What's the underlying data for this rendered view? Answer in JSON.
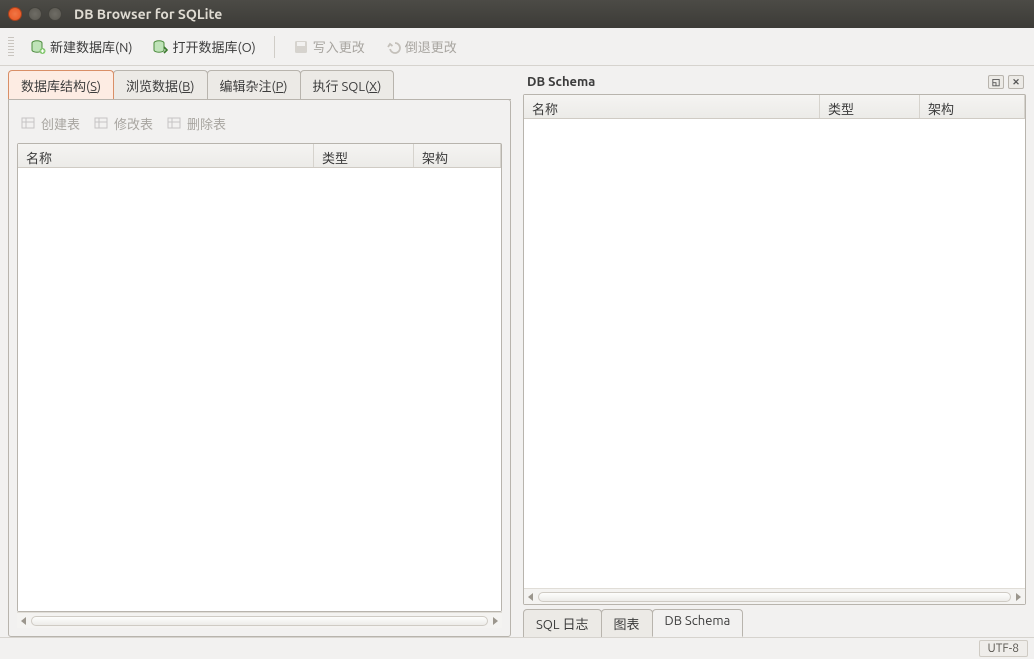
{
  "window": {
    "title": "DB Browser for SQLite"
  },
  "toolbar": {
    "new_db": "新建数据库(N)",
    "open_db": "打开数据库(O)",
    "write_changes": "写入更改",
    "revert_changes": "倒退更改"
  },
  "tabs": {
    "structure": {
      "label": "数据库结构(",
      "mn": "S",
      "tail": ")"
    },
    "browse": {
      "label": "浏览数据(",
      "mn": "B",
      "tail": ")"
    },
    "edit": {
      "label": "编辑杂注(",
      "mn": "P",
      "tail": ")"
    },
    "sql": {
      "label": "执行 SQL(",
      "mn": "X",
      "tail": ")"
    }
  },
  "subtoolbar": {
    "create_table": "创建表",
    "modify_table": "修改表",
    "delete_table": "删除表"
  },
  "left_columns": {
    "name": "名称",
    "type": "类型",
    "schema": "架构"
  },
  "right_panel": {
    "title": "DB Schema",
    "columns": {
      "name": "名称",
      "type": "类型",
      "schema": "架构"
    }
  },
  "bottom_tabs": {
    "sql_log": "SQL 日志",
    "chart": "图表",
    "db_schema": "DB Schema"
  },
  "status": {
    "encoding": "UTF-8"
  }
}
